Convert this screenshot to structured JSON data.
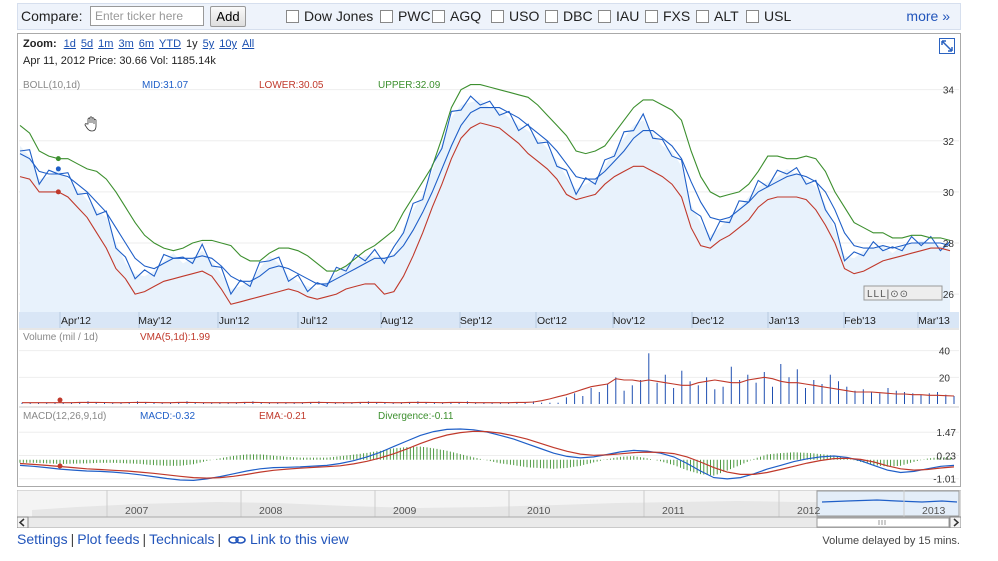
{
  "compare": {
    "label": "Compare:",
    "input_placeholder": "Enter ticker here",
    "add_label": "Add",
    "items": [
      "Dow Jones",
      "PWC",
      "AGQ",
      "USO",
      "DBC",
      "IAU",
      "FXS",
      "ALT",
      "USL"
    ],
    "more_label": "more »"
  },
  "zoom": {
    "label": "Zoom:",
    "options": [
      "1d",
      "5d",
      "1m",
      "3m",
      "6m",
      "YTD",
      "1y",
      "5y",
      "10y",
      "All"
    ],
    "active": "1y"
  },
  "info": {
    "text": "Apr 11, 2012 Price: 30.66 Vol: 1185.14k"
  },
  "boll": {
    "label": "BOLL(10,1d)",
    "mid": "MID:31.07",
    "lower": "LOWER:30.05",
    "upper": "UPPER:32.09"
  },
  "volume_panel": {
    "label": "Volume (mil / 1d)",
    "vma": "VMA(5,1d):1.99"
  },
  "macd_panel": {
    "label": "MACD(12,26,9,1d)",
    "macd": "MACD:-0.32",
    "ema": "EMA:-0.21",
    "divergence": "Divergence:-0.11"
  },
  "colors": {
    "price": "#1f5fc8",
    "mid": "#1f5fc8",
    "lower": "#c0392b",
    "upper": "#3c8f2e",
    "divergence": "#3c8f2e",
    "volume": "#1f4fb0"
  },
  "chart_data": [
    {
      "type": "line",
      "x_labels": [
        "Apr'12",
        "May'12",
        "Jun'12",
        "Jul'12",
        "Aug'12",
        "Sep'12",
        "Oct'12",
        "Nov'12",
        "Dec'12",
        "Jan'13",
        "Feb'13",
        "Mar'13"
      ],
      "y_ticks": [
        "34",
        "32",
        "30",
        "28",
        "26"
      ],
      "ylim": [
        25.3,
        34.3
      ],
      "series": [
        {
          "name": "Price",
          "values": [
            31.8,
            31.4,
            30.5,
            30.6,
            30.9,
            30.5,
            30.1,
            29.7,
            29.3,
            29.0,
            28.0,
            27.2,
            26.8,
            26.7,
            26.9,
            27.3,
            27.6,
            27.2,
            27.4,
            27.7,
            27.3,
            26.8,
            26.2,
            26.3,
            26.5,
            27.0,
            27.5,
            27.2,
            26.7,
            26.5,
            26.3,
            26.2,
            26.5,
            26.8,
            27.1,
            27.3,
            27.5,
            27.5,
            27.4,
            27.6,
            28.6,
            29.3,
            29.9,
            30.8,
            31.9,
            32.9,
            33.4,
            33.5,
            33.6,
            33.3,
            33.2,
            32.9,
            32.6,
            32.4,
            32.1,
            31.7,
            31.2,
            30.6,
            30.1,
            30.3,
            30.5,
            31.0,
            31.6,
            32.1,
            32.6,
            32.8,
            32.3,
            31.8,
            31.6,
            31.0,
            29.5,
            28.8,
            28.3,
            28.6,
            29.0,
            29.4,
            29.8,
            30.2,
            30.4,
            30.6,
            30.9,
            30.7,
            30.5,
            30.2,
            29.5,
            28.5,
            27.5,
            27.4,
            27.7,
            27.8,
            27.9,
            27.6,
            27.9,
            28.0,
            28.1,
            28.0,
            27.9,
            27.8
          ]
        },
        {
          "name": "MID",
          "values": [
            31.5,
            31.3,
            30.8,
            30.7,
            30.7,
            30.6,
            30.3,
            30.0,
            29.6,
            29.2,
            28.6,
            28.0,
            27.4,
            27.1,
            27.0,
            27.2,
            27.4,
            27.4,
            27.4,
            27.5,
            27.4,
            27.1,
            26.7,
            26.5,
            26.5,
            26.7,
            27.0,
            27.1,
            27.0,
            26.8,
            26.6,
            26.4,
            26.4,
            26.6,
            26.8,
            27.0,
            27.2,
            27.4,
            27.4,
            27.5,
            27.9,
            28.5,
            29.2,
            30.0,
            30.9,
            31.8,
            32.6,
            33.1,
            33.3,
            33.3,
            33.3,
            33.1,
            32.9,
            32.6,
            32.3,
            32.0,
            31.6,
            31.1,
            30.6,
            30.5,
            30.5,
            30.8,
            31.2,
            31.6,
            32.1,
            32.4,
            32.4,
            32.1,
            31.8,
            31.3,
            30.4,
            29.6,
            29.0,
            28.9,
            29.0,
            29.3,
            29.6,
            30.0,
            30.2,
            30.4,
            30.6,
            30.7,
            30.6,
            30.4,
            30.0,
            29.3,
            28.4,
            27.9,
            27.8,
            27.8,
            27.9,
            27.8,
            27.9,
            28.0,
            28.0,
            28.0,
            28.0,
            27.9
          ]
        },
        {
          "name": "LOWER",
          "values": [
            30.6,
            30.5,
            30.0,
            30.0,
            30.0,
            29.8,
            29.4,
            29.0,
            28.4,
            27.8,
            27.0,
            26.6,
            26.0,
            26.1,
            26.3,
            26.5,
            26.6,
            26.7,
            26.8,
            26.9,
            26.7,
            26.2,
            25.6,
            25.7,
            25.8,
            25.9,
            26.0,
            26.1,
            26.2,
            26.1,
            25.9,
            25.8,
            25.9,
            26.0,
            26.2,
            26.3,
            26.4,
            26.4,
            26.0,
            26.1,
            26.7,
            27.5,
            28.4,
            29.4,
            30.3,
            31.3,
            32.1,
            32.5,
            32.7,
            32.6,
            32.5,
            32.2,
            31.9,
            31.5,
            31.2,
            30.9,
            30.5,
            29.9,
            29.7,
            29.8,
            29.9,
            30.3,
            30.6,
            30.8,
            31.0,
            31.0,
            30.8,
            30.6,
            30.3,
            29.8,
            28.6,
            27.9,
            27.8,
            28.1,
            28.3,
            28.6,
            28.9,
            29.4,
            29.7,
            29.8,
            29.8,
            29.8,
            29.7,
            29.3,
            28.7,
            28.0,
            27.0,
            26.8,
            26.9,
            27.1,
            27.3,
            27.4,
            27.5,
            27.6,
            27.7,
            27.8,
            27.8,
            27.7
          ]
        },
        {
          "name": "UPPER",
          "values": [
            32.6,
            32.3,
            31.6,
            31.4,
            31.3,
            31.3,
            31.1,
            30.9,
            30.8,
            30.5,
            30.0,
            29.4,
            28.8,
            28.3,
            28.0,
            27.8,
            27.7,
            27.8,
            28.0,
            28.1,
            28.1,
            28.0,
            27.9,
            27.5,
            27.3,
            27.3,
            27.6,
            27.8,
            27.8,
            27.7,
            27.5,
            27.2,
            26.9,
            26.9,
            27.1,
            27.4,
            27.7,
            27.9,
            28.2,
            28.5,
            29.2,
            29.8,
            30.4,
            31.0,
            32.1,
            33.3,
            34.0,
            34.2,
            34.2,
            34.1,
            34.0,
            33.9,
            33.8,
            33.7,
            33.4,
            33.0,
            32.6,
            32.2,
            31.6,
            31.5,
            31.6,
            31.8,
            32.3,
            32.8,
            33.3,
            33.6,
            33.6,
            33.4,
            33.2,
            32.8,
            31.6,
            30.6,
            30.0,
            29.8,
            29.9,
            30.0,
            30.3,
            30.8,
            31.4,
            31.4,
            31.3,
            31.3,
            31.4,
            31.3,
            30.8,
            30.0,
            29.4,
            28.8,
            28.6,
            28.4,
            28.4,
            28.2,
            28.2,
            28.3,
            28.3,
            28.2,
            28.2,
            28.1
          ]
        }
      ]
    },
    {
      "type": "bar",
      "title": "Volume (mil / 1d)",
      "y_ticks": [
        "40",
        "20"
      ],
      "ylim": [
        0,
        45
      ],
      "values": [
        1,
        1,
        1,
        1,
        1,
        1,
        1,
        1,
        2,
        1,
        1,
        1,
        1,
        1,
        2,
        1,
        1,
        1,
        1,
        1,
        2,
        1,
        1,
        1,
        1,
        1,
        1,
        1,
        2,
        1,
        1,
        1,
        1,
        1,
        1,
        1,
        2,
        1,
        1,
        1,
        1,
        1,
        2,
        1,
        1,
        1,
        1,
        1,
        2,
        1,
        1,
        1,
        1,
        1,
        2,
        1,
        1,
        1,
        1,
        1,
        1,
        1,
        2,
        1,
        1,
        1,
        5,
        8,
        6,
        12,
        9,
        15,
        20,
        10,
        14,
        18,
        38,
        16,
        22,
        12,
        25,
        17,
        14,
        20,
        11,
        13,
        28,
        18,
        22,
        16,
        24,
        13,
        30,
        20,
        26,
        12,
        18,
        15,
        22,
        17,
        13,
        10,
        11,
        9,
        8,
        12,
        10,
        9,
        8,
        7,
        8,
        9,
        7,
        6
      ],
      "vma": [
        1,
        1,
        1,
        1,
        1,
        1,
        1,
        1.2,
        1.2,
        1.2,
        1.1,
        1,
        1,
        1.1,
        1.2,
        1.2,
        1.1,
        1,
        1,
        1.2,
        1.2,
        1.1,
        1,
        1,
        1,
        1,
        1,
        1.2,
        1.2,
        1.1,
        1,
        1,
        1,
        1,
        1,
        1.2,
        1.2,
        1.1,
        1,
        1,
        1,
        1.2,
        1.2,
        1.2,
        1.1,
        1,
        1,
        1.2,
        1.2,
        1.2,
        1.1,
        1,
        1.2,
        1.2,
        1.1,
        1,
        1,
        1,
        1,
        1,
        1.2,
        1.2,
        1.5,
        2.5,
        3.8,
        5.5,
        7,
        9,
        11,
        13,
        14,
        15,
        19,
        18,
        18,
        17,
        18,
        17,
        16,
        15,
        14,
        14,
        16,
        17,
        18,
        17,
        16,
        16,
        18,
        19,
        20,
        19,
        17,
        16,
        16,
        15,
        14,
        13,
        12,
        11,
        10,
        9,
        9,
        9,
        8.5,
        8,
        7.5,
        7.5,
        7,
        7,
        6.5,
        6.5,
        6.2,
        6
      ]
    },
    {
      "type": "line",
      "title": "MACD(12,26,9,1d)",
      "y_ticks": [
        "1.47",
        "0.23",
        "-1.01"
      ],
      "ylim": [
        -1.4,
        1.8
      ],
      "series": [
        {
          "name": "MACD",
          "values": [
            -0.3,
            -0.35,
            -0.42,
            -0.5,
            -0.55,
            -0.6,
            -0.62,
            -0.66,
            -0.72,
            -0.8,
            -0.9,
            -1.0,
            -1.08,
            -1.1,
            -1.02,
            -0.9,
            -0.75,
            -0.6,
            -0.48,
            -0.42,
            -0.4,
            -0.38,
            -0.34,
            -0.3,
            -0.2,
            -0.05,
            0.15,
            0.4,
            0.7,
            1.0,
            1.3,
            1.5,
            1.62,
            1.64,
            1.6,
            1.48,
            1.3,
            1.1,
            0.85,
            0.6,
            0.35,
            0.18,
            0.1,
            0.15,
            0.28,
            0.42,
            0.5,
            0.46,
            0.35,
            0.15,
            -0.2,
            -0.6,
            -0.95,
            -1.02,
            -0.95,
            -0.75,
            -0.5,
            -0.3,
            -0.1,
            0.05,
            0.15,
            0.2,
            0.12,
            -0.05,
            -0.3,
            -0.55,
            -0.68,
            -0.62,
            -0.48,
            -0.35,
            -0.3
          ]
        },
        {
          "name": "EMA",
          "values": [
            -0.2,
            -0.25,
            -0.3,
            -0.36,
            -0.42,
            -0.48,
            -0.52,
            -0.56,
            -0.6,
            -0.66,
            -0.72,
            -0.8,
            -0.88,
            -0.95,
            -0.98,
            -0.95,
            -0.88,
            -0.78,
            -0.66,
            -0.56,
            -0.5,
            -0.45,
            -0.41,
            -0.37,
            -0.32,
            -0.22,
            -0.08,
            0.1,
            0.32,
            0.58,
            0.86,
            1.12,
            1.32,
            1.45,
            1.52,
            1.5,
            1.42,
            1.28,
            1.1,
            0.88,
            0.65,
            0.45,
            0.3,
            0.24,
            0.26,
            0.32,
            0.38,
            0.41,
            0.4,
            0.33,
            0.15,
            -0.12,
            -0.42,
            -0.66,
            -0.78,
            -0.78,
            -0.68,
            -0.52,
            -0.35,
            -0.18,
            -0.04,
            0.06,
            0.08,
            0.02,
            -0.12,
            -0.32,
            -0.48,
            -0.55,
            -0.52,
            -0.44,
            -0.38
          ]
        }
      ]
    }
  ],
  "scroller": {
    "years": [
      "2007",
      "2008",
      "2009",
      "2010",
      "2011",
      "2012",
      "2013"
    ]
  },
  "footer": {
    "settings": "Settings",
    "plot_feeds": "Plot feeds",
    "technicals": "Technicals",
    "link_view": "Link to this view",
    "delayed_note": "Volume delayed by 15 mins."
  }
}
